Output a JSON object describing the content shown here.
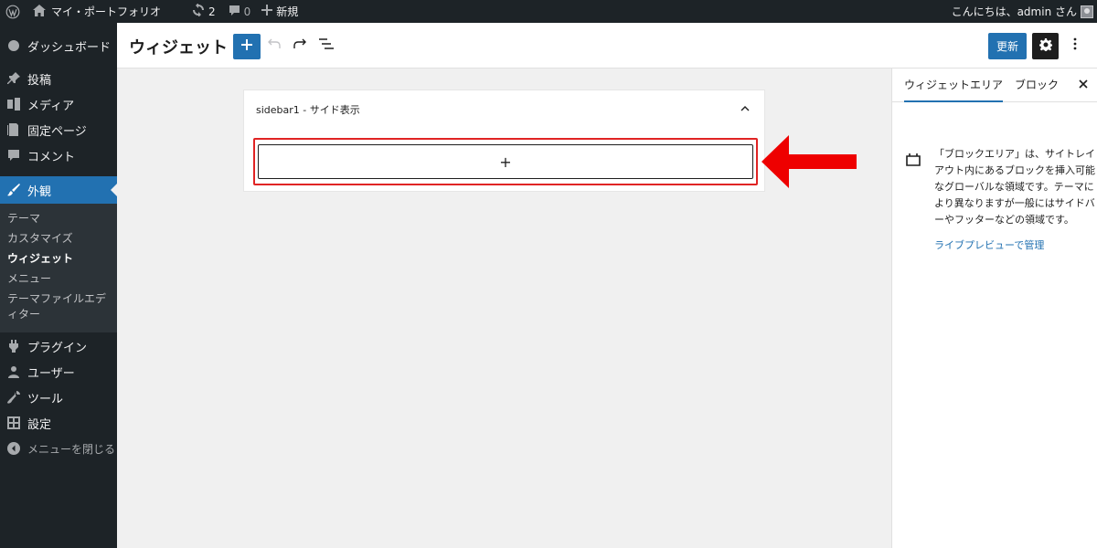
{
  "admin_bar": {
    "site_name": "マイ・ポートフォリオ",
    "updates_count": "2",
    "comments_count": "0",
    "new_label": "新規",
    "greeting": "こんにちは、admin さん"
  },
  "sidebar": {
    "dashboard": "ダッシュボード",
    "posts": "投稿",
    "media": "メディア",
    "pages": "固定ページ",
    "comments": "コメント",
    "appearance": "外観",
    "submenu": {
      "themes": "テーマ",
      "customize": "カスタマイズ",
      "widgets": "ウィジェット",
      "menus": "メニュー",
      "theme_file_editor": "テーマファイルエディター"
    },
    "plugins": "プラグイン",
    "users": "ユーザー",
    "tools": "ツール",
    "settings": "設定",
    "collapse": "メニューを閉じる"
  },
  "header": {
    "title": "ウィジェット",
    "update_label": "更新"
  },
  "canvas": {
    "widget_area_title": "sidebar1 - サイド表示",
    "appender_label": "+"
  },
  "settings_panel": {
    "tab_widget_areas": "ウィジェットエリア",
    "tab_block": "ブロック",
    "description": "「ブロックエリア」は、サイトレイアウト内にあるブロックを挿入可能なグローバルな領域です。テーマにより異なりますが一般にはサイドバーやフッターなどの領域です。",
    "live_preview_link": "ライブプレビューで管理"
  },
  "colors": {
    "accent": "#2271b1",
    "admin_dark": "#1d2327",
    "highlight_red": "#e02424"
  }
}
